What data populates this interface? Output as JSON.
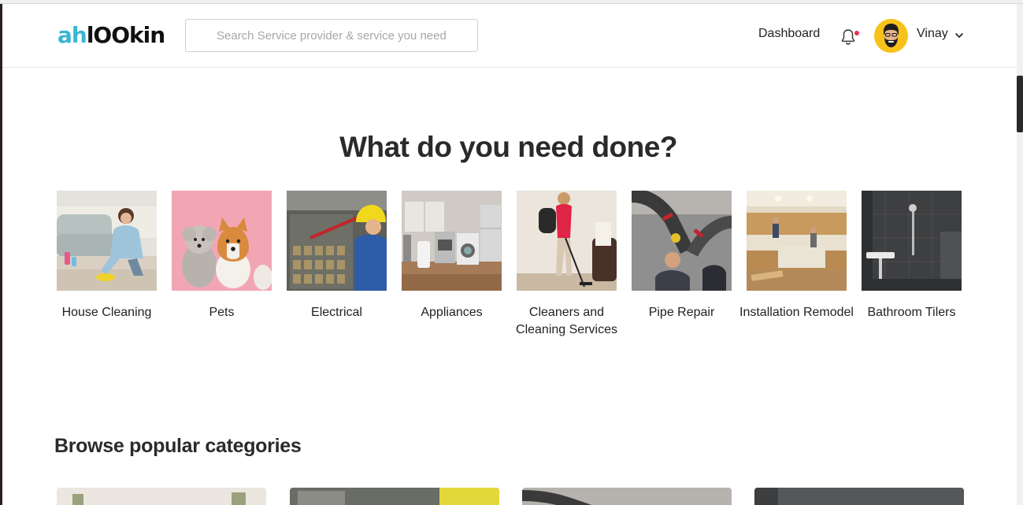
{
  "header": {
    "logo_part1": "ah",
    "logo_part2": "lOOkin",
    "search_placeholder": "Search Service provider & service you need",
    "nav_dashboard": "Dashboard",
    "user_name": "Vinay"
  },
  "colors": {
    "brand_cyan": "#37b7d3",
    "notification_dot": "#e8344a",
    "avatar_bg": "#f7c21a"
  },
  "hero": {
    "title": "What do you need done?"
  },
  "categories": [
    {
      "label": "House Cleaning",
      "icon": "house-cleaning-image"
    },
    {
      "label": "Pets",
      "icon": "pets-image"
    },
    {
      "label": "Electrical",
      "icon": "electrical-image"
    },
    {
      "label": "Appliances",
      "icon": "appliances-image"
    },
    {
      "label": "Cleaners and Cleaning Services",
      "icon": "cleaners-image"
    },
    {
      "label": "Pipe Repair",
      "icon": "pipe-repair-image"
    },
    {
      "label": "Installation Remodel",
      "icon": "installation-image"
    },
    {
      "label": "Bathroom Tilers",
      "icon": "bathroom-image"
    }
  ],
  "popular": {
    "title": "Browse popular categories"
  }
}
